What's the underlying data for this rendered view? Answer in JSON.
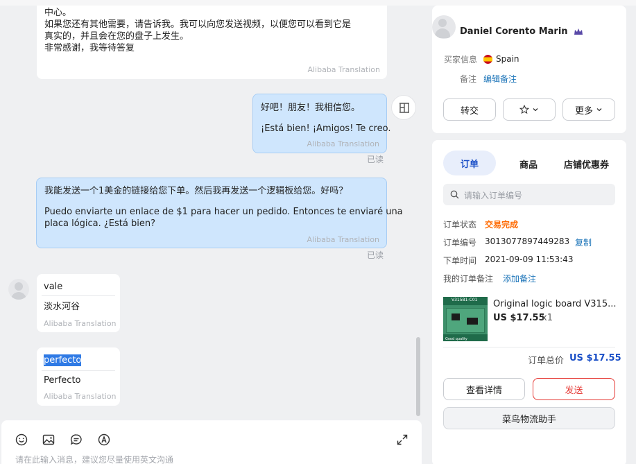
{
  "messages": [
    {
      "lines": [
        "中心。",
        "如果您还有其他需要，请告诉我。我可以向您发送视频，以便您可以看到它是",
        "真实的，并且会在您的盘子上发生。",
        "非常感谢，我等待答复"
      ],
      "translation": "Alibaba Translation"
    },
    {
      "original": "好吧！朋友！我相信您。",
      "translated": "¡Está bien! ¡Amigos! Te creo.",
      "translation": "Alibaba Translation",
      "status": "已读"
    },
    {
      "original": "我能发送一个1美金的链接给您下单。然后我再发送一个逻辑板给您。好吗？",
      "translated_lines": [
        "Puedo enviarte un enlace de $1 para hacer un pedido. Entonces te enviaré una",
        "placa lógica. ¿Está bien?"
      ],
      "translation": "Alibaba Translation",
      "status": "已读"
    },
    {
      "original": "vale",
      "translated": "淡水河谷",
      "translation": "Alibaba Translation"
    },
    {
      "original": "perfecto",
      "translated": "Perfecto",
      "translation": "Alibaba Translation"
    }
  ],
  "composer": {
    "placeholder": "请在此输入消息，建议您尽量使用英文沟通",
    "tools": [
      "emoji-icon",
      "image-icon",
      "quick-reply-icon",
      "translate-icon",
      "expand-icon"
    ]
  },
  "buyer": {
    "name": "Daniel Corento Marin",
    "info_label": "买家信息",
    "country": "Spain",
    "note_label": "备注",
    "note_link": "编辑备注",
    "buttons": {
      "transfer": "转交",
      "more": "更多"
    }
  },
  "tabs": [
    "订单",
    "商品",
    "店铺优惠券"
  ],
  "search": {
    "placeholder": "请输入订单编号"
  },
  "order": {
    "status_label": "订单状态",
    "status": "交易完成",
    "id_label": "订单编号",
    "id": "3013077897449283",
    "copy": "复制",
    "time_label": "下单时间",
    "time": "2021-09-09 11:53:43",
    "remark_label": "我的订单备注",
    "remark_link": "添加备注",
    "product_title": "Original logic board V315...",
    "price": "US $17.55",
    "qty": "x1",
    "thumb_top": "V315B1-C01",
    "thumb_bottom": "Good quality",
    "total_label": "订单总价",
    "total": "US $17.55",
    "details_btn": "查看详情",
    "send_btn": "发送",
    "logistics_btn": "菜鸟物流助手"
  },
  "colors": {
    "accent": "#1a73b8",
    "status_orange": "#ff6a00",
    "send_red": "#e53935",
    "total_blue": "#1a4fc7",
    "bubble_out": "#cfe6fd"
  }
}
